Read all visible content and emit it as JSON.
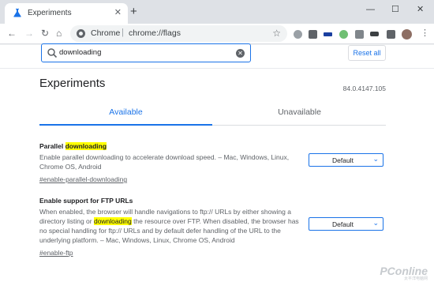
{
  "browser": {
    "tab_title": "Experiments",
    "tab_close": "✕",
    "new_tab": "+",
    "win_min": "—",
    "win_max": "☐",
    "win_close": "✕",
    "back": "←",
    "forward": "→",
    "reload": "↻",
    "home": "⌂",
    "omnibox_scheme": "Chrome",
    "omnibox_sep": "|",
    "omnibox_url": "chrome://flags",
    "star": "☆"
  },
  "search": {
    "value": "downloading",
    "clear": "✕",
    "reset_label": "Reset all"
  },
  "header": {
    "title": "Experiments",
    "version": "84.0.4147.105"
  },
  "tabs": {
    "available": "Available",
    "unavailable": "Unavailable"
  },
  "flags": [
    {
      "title_pre": "Parallel ",
      "title_hl": "downloading",
      "desc": "Enable parallel downloading to accelerate download speed. – Mac, Windows, Linux, Chrome OS, Android",
      "link": "#enable-parallel-downloading",
      "value": "Default"
    },
    {
      "title": "Enable support for FTP URLs",
      "desc_a": "When enabled, the browser will handle navigations to ftp:// URLs by either showing a directory listing or ",
      "desc_hl": "downloading",
      "desc_b": " the resource over FTP. When disabled, the browser has no special handling for ftp:// URLs and by default defer handling of the URL to the underlying platform. – Mac, Windows, Linux, Chrome OS, Android",
      "link": "#enable-ftp",
      "value": "Default"
    }
  ],
  "watermark": {
    "logo": "PConline",
    "sub": "太平洋电脑网"
  },
  "colors": {
    "accent": "#1a73e8",
    "highlight": "#ffff00",
    "tabstrip": "#dee1e6"
  }
}
